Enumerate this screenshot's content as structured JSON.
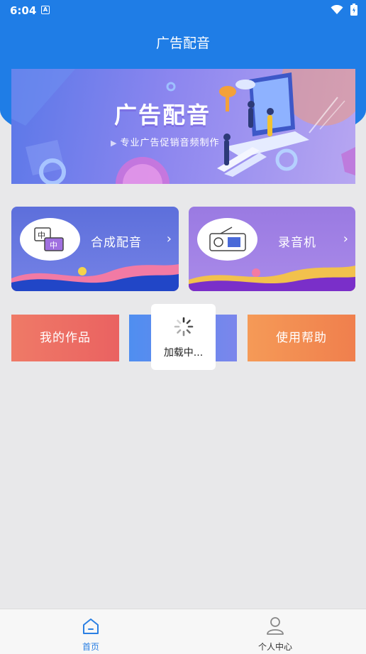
{
  "status": {
    "time": "6:04",
    "app_badge": "A"
  },
  "header": {
    "title": "广告配音"
  },
  "banner": {
    "title": "广告配音",
    "subtitle": "专业广告促销音频制作"
  },
  "cards": [
    {
      "label": "合成配音",
      "icon_text_top": "中",
      "icon_text_bottom": "中"
    },
    {
      "label": "录音机"
    }
  ],
  "tiles": [
    {
      "label": "我的作品"
    },
    {
      "label": ""
    },
    {
      "label": "使用帮助"
    }
  ],
  "loading": {
    "text": "加载中..."
  },
  "nav": [
    {
      "label": "首页",
      "icon": "home-icon",
      "active": true
    },
    {
      "label": "个人中心",
      "icon": "person-icon",
      "active": false
    }
  ],
  "colors": {
    "primary": "#1f7de6",
    "active_nav": "#2a7fe3",
    "tile_works": "#ea6261",
    "tile_help": "#f07f4d"
  }
}
